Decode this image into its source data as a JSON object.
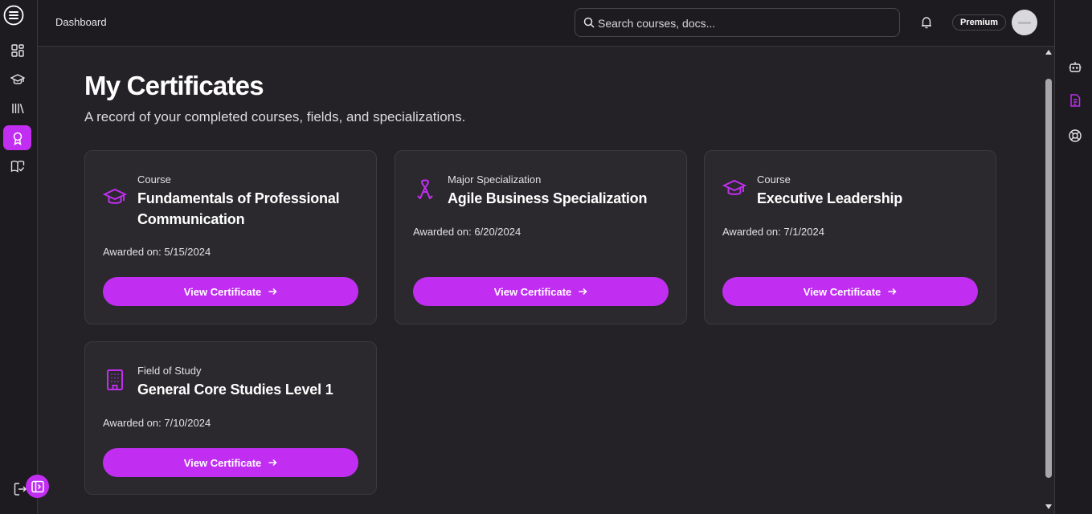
{
  "header": {
    "breadcrumb": "Dashboard",
    "search_placeholder": "Search courses, docs...",
    "plan_badge": "Premium"
  },
  "page": {
    "title": "My Certificates",
    "subtitle": "A record of your completed courses, fields, and specializations."
  },
  "sidebar": {
    "items": [
      {
        "name": "dashboard-icon"
      },
      {
        "name": "graduation-cap-icon"
      },
      {
        "name": "library-icon"
      },
      {
        "name": "award-icon",
        "active": true
      },
      {
        "name": "book-check-icon"
      }
    ]
  },
  "certificates": [
    {
      "type": "Course",
      "title": "Fundamentals of Professional Communication",
      "awarded": "Awarded on: 5/15/2024",
      "button": "View Certificate",
      "icon": "graduation-cap-icon"
    },
    {
      "type": "Major Specialization",
      "title": "Agile Business Specialization",
      "awarded": "Awarded on: 6/20/2024",
      "button": "View Certificate",
      "icon": "ribbon-icon"
    },
    {
      "type": "Course",
      "title": "Executive Leadership",
      "awarded": "Awarded on: 7/1/2024",
      "button": "View Certificate",
      "icon": "graduation-cap-icon"
    },
    {
      "type": "Field of Study",
      "title": "General Core Studies Level 1",
      "awarded": "Awarded on: 7/10/2024",
      "button": "View Certificate",
      "icon": "building-icon"
    }
  ],
  "colors": {
    "accent": "#c12ef2",
    "background": "#242226",
    "card": "#2b292d",
    "sidebar": "#1d1b1f"
  }
}
